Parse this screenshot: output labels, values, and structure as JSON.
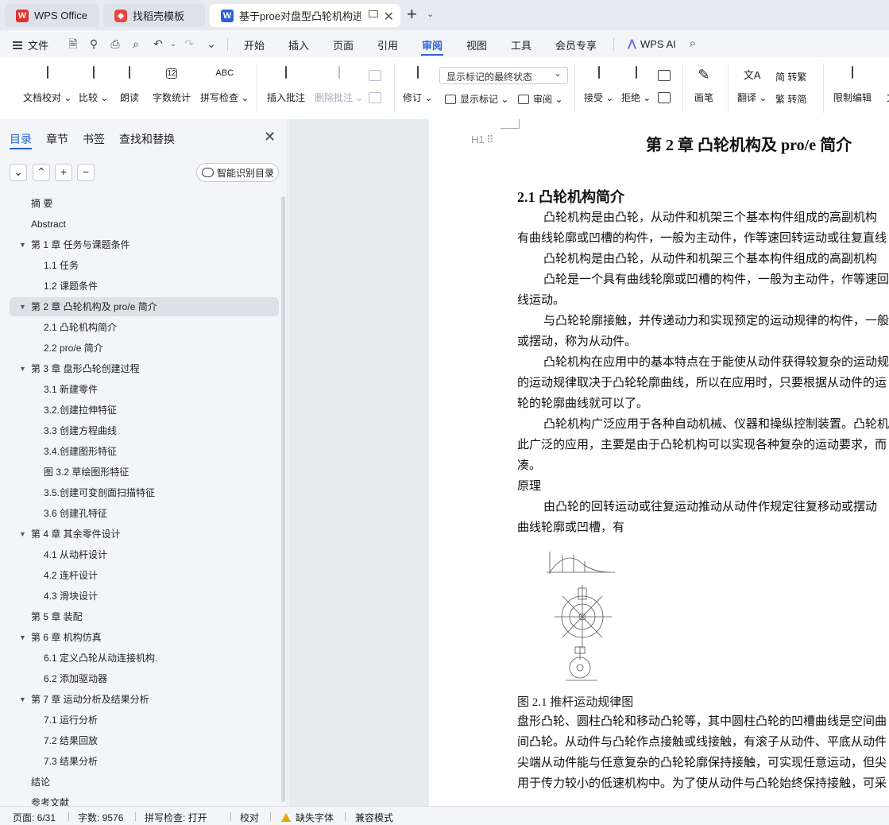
{
  "tabs": [
    {
      "label": "WPS Office",
      "icon": "wps-logo-icon"
    },
    {
      "label": "找稻壳模板",
      "icon": "docer-icon"
    },
    {
      "label": "基于proe对盘型凸轮机构进行",
      "icon": "writer-icon"
    }
  ],
  "menu": {
    "file": "文件",
    "items": [
      "开始",
      "插入",
      "页面",
      "引用",
      "审阅",
      "视图",
      "工具",
      "会员专享"
    ],
    "active": "审阅",
    "wps_ai": "WPS AI"
  },
  "ribbon": {
    "doc_check": "文档校对",
    "compare": "比较",
    "read_aloud": "朗读",
    "word_count": "字数统计",
    "spell_check": "拼写检查",
    "insert_comment": "插入批注",
    "delete_comment": "删除批注",
    "revise": "修订",
    "markup_select": "显示标记的最终状态",
    "show_markup": "显示标记",
    "review": "审阅",
    "accept": "接受",
    "reject": "拒绝",
    "pen": "画笔",
    "translate": "翻译",
    "to_traditional": "简 转繁",
    "to_simplified": "繁 转简",
    "restrict_edit": "限制编辑",
    "more": "文"
  },
  "nav": {
    "tabs": [
      "目录",
      "章节",
      "书签",
      "查找和替换"
    ],
    "active_tab": "目录",
    "smart_toc": "智能识别目录",
    "items": [
      {
        "text": "摘  要",
        "level": 1,
        "arrow": false
      },
      {
        "text": "Abstract",
        "level": 1,
        "arrow": false
      },
      {
        "text": "第 1 章    任务与课题条件",
        "level": 1,
        "arrow": true
      },
      {
        "text": "1.1  任务",
        "level": 2,
        "arrow": false
      },
      {
        "text": "1.2  课题条件",
        "level": 2,
        "arrow": false
      },
      {
        "text": "第 2 章  凸轮机构及 pro/e 简介",
        "level": 1,
        "arrow": true,
        "selected": true
      },
      {
        "text": "2.1  凸轮机构简介",
        "level": 2,
        "arrow": false
      },
      {
        "text": "2.2 pro/e 简介",
        "level": 2,
        "arrow": false
      },
      {
        "text": "第 3 章  盘形凸轮创建过程",
        "level": 1,
        "arrow": true
      },
      {
        "text": "3.1  新建零件",
        "level": 2,
        "arrow": false
      },
      {
        "text": "3.2.创建拉伸特征",
        "level": 2,
        "arrow": false
      },
      {
        "text": "3.3  创建方程曲线",
        "level": 2,
        "arrow": false
      },
      {
        "text": "3.4.创建图形特征",
        "level": 2,
        "arrow": false
      },
      {
        "text": "图 3.2  草绘图形特征",
        "level": 2,
        "arrow": false
      },
      {
        "text": "3.5.创建可变剖面扫描特征",
        "level": 2,
        "arrow": false
      },
      {
        "text": "3.6 创建孔特征",
        "level": 2,
        "arrow": false
      },
      {
        "text": "第 4 章    其余零件设计",
        "level": 1,
        "arrow": true
      },
      {
        "text": "4.1 从动杆设计",
        "level": 2,
        "arrow": false
      },
      {
        "text": "4.2 连杆设计",
        "level": 2,
        "arrow": false
      },
      {
        "text": "4.3 滑块设计",
        "level": 2,
        "arrow": false
      },
      {
        "text": "第 5 章  装配",
        "level": 1,
        "arrow": false
      },
      {
        "text": "第 6 章  机构仿真",
        "level": 1,
        "arrow": true
      },
      {
        "text": "6.1  定义凸轮从动连接机构.",
        "level": 2,
        "arrow": false
      },
      {
        "text": "6.2  添加驱动器",
        "level": 2,
        "arrow": false
      },
      {
        "text": "第 7 章    运动分析及结果分析",
        "level": 1,
        "arrow": true
      },
      {
        "text": "7.1  运行分析",
        "level": 2,
        "arrow": false
      },
      {
        "text": "7.2    结果回放",
        "level": 2,
        "arrow": false
      },
      {
        "text": "7.3    结果分析",
        "level": 2,
        "arrow": false
      },
      {
        "text": "结论",
        "level": 1,
        "arrow": false
      },
      {
        "text": "参考文献",
        "level": 1,
        "arrow": false
      }
    ]
  },
  "document": {
    "heading_marker": "H1",
    "chapter_title": "第 2 章  凸轮机构及 pro/e 简介",
    "section_title": "2.1  凸轮机构简介",
    "lines": [
      {
        "text": "凸轮机构是由凸轮，从动件和机架三个基本构件组成的高副机构",
        "indent": true
      },
      {
        "text": "有曲线轮廓或凹槽的构件，一般为主动件，作等速回转运动或往复直线",
        "indent": false
      },
      {
        "text": "凸轮机构是由凸轮，从动件和机架三个基本构件组成的高副机构",
        "indent": true
      },
      {
        "text": "凸轮是一个具有曲线轮廓或凹槽的构件，一般为主动件，作等速回",
        "indent": true
      },
      {
        "text": "线运动。",
        "indent": false
      },
      {
        "text": "与凸轮轮廓接触，并传递动力和实现预定的运动规律的构件，一般",
        "indent": true
      },
      {
        "text": "或摆动，称为从动件。",
        "indent": false
      },
      {
        "text": "凸轮机构在应用中的基本特点在于能使从动件获得较复杂的运动规",
        "indent": true
      },
      {
        "text": "的运动规律取决于凸轮轮廓曲线，所以在应用时，只要根据从动件的运",
        "indent": false
      },
      {
        "text": "轮的轮廓曲线就可以了。",
        "indent": false
      },
      {
        "text": "凸轮机构广泛应用于各种自动机械、仪器和操纵控制装置。凸轮机",
        "indent": true
      },
      {
        "text": "此广泛的应用，主要是由于凸轮机构可以实现各种复杂的运动要求，而",
        "indent": false
      },
      {
        "text": "凑。",
        "indent": false
      },
      {
        "text": "原理",
        "indent": false
      },
      {
        "text": "由凸轮的回转运动或往复运动推动从动件作规定往复移动或摆动",
        "indent": true
      },
      {
        "text": "曲线轮廓或凹槽，有",
        "indent": false
      }
    ],
    "figure_caption": "图 2.1  推杆运动规律图",
    "after_lines": [
      "盘形凸轮、圆柱凸轮和移动凸轮等，其中圆柱凸轮的凹槽曲线是空间曲",
      "间凸轮。从动件与凸轮作点接触或线接触，有滚子从动件、平底从动件",
      "尖端从动件能与任意复杂的凸轮轮廓保持接触，可实现任意运动，但尖",
      "用于传力较小的低速机构中。为了使从动件与凸轮始终保持接触，可采"
    ]
  },
  "status": {
    "page": "页面: 6/31",
    "word_count": "字数: 9576",
    "spell_check": "拼写检查: 打开",
    "proofread": "校对",
    "missing_fonts": "缺失字体",
    "compat_mode": "兼容模式"
  }
}
